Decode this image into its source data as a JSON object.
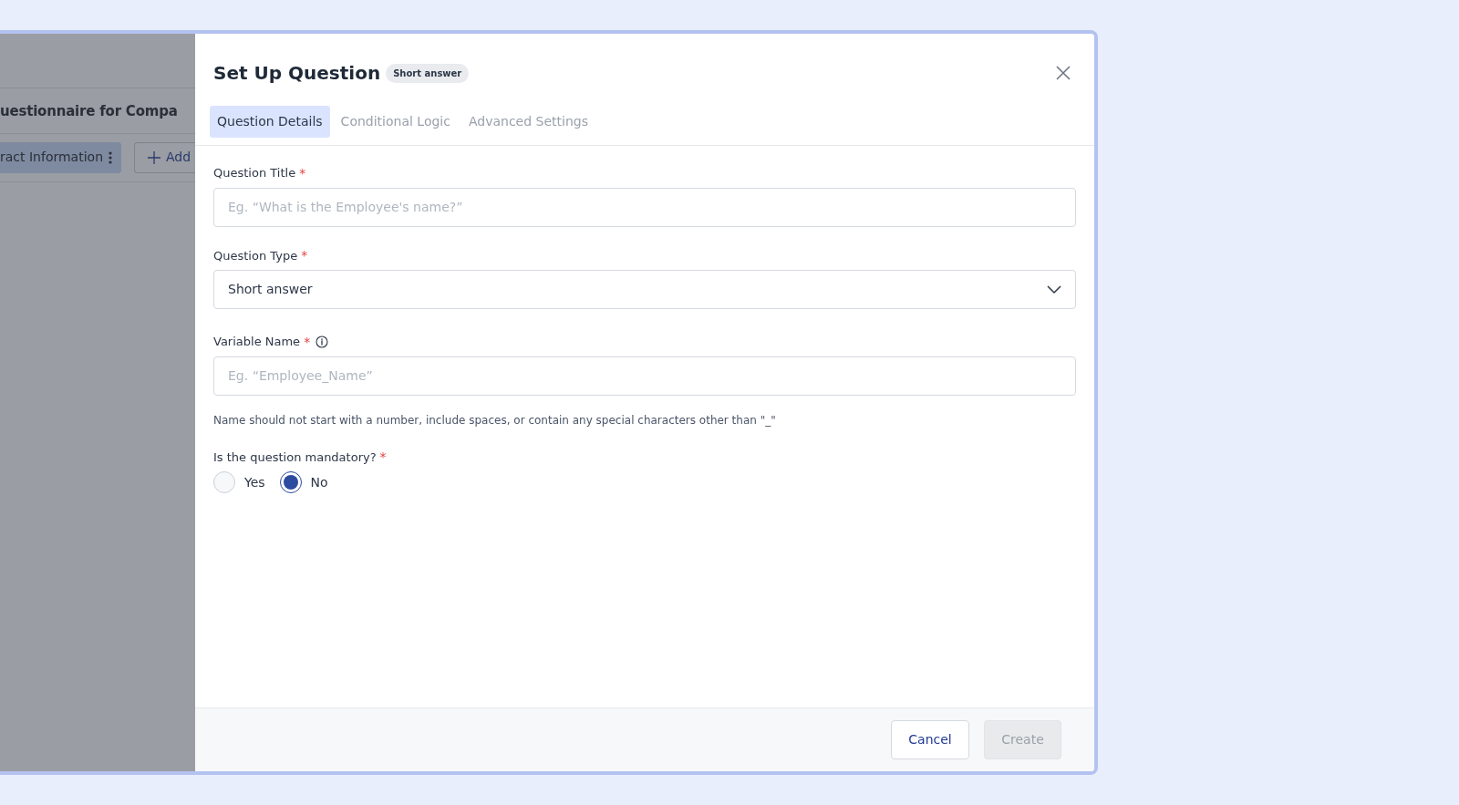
{
  "background_page": {
    "title": "uestionnaire for Compa",
    "section_tab": "ract Information",
    "add_button": "Add"
  },
  "dialog": {
    "title": "Set Up Question",
    "badge": "Short answer",
    "tabs": [
      {
        "label": "Question Details",
        "selected": true
      },
      {
        "label": "Conditional Logic",
        "selected": false
      },
      {
        "label": "Advanced Settings",
        "selected": false
      }
    ],
    "fields": [
      {
        "kind": "text",
        "label": "Question Title",
        "required_mark": "*",
        "placeholder": "Eg. “What is the Employee's name?”"
      },
      {
        "kind": "select",
        "label": "Question Type",
        "required_mark": "*",
        "value": "Short answer"
      },
      {
        "kind": "text",
        "label": "Variable Name",
        "required_mark": "*",
        "info": true,
        "placeholder": "Eg. “Employee_Name”",
        "hint": "Name should not start with a number, include spaces, or contain any special characters other than \"_\""
      },
      {
        "kind": "radio",
        "label": "Is the question mandatory?",
        "required_mark": "*",
        "options": [
          {
            "label": "Yes",
            "selected": false
          },
          {
            "label": "No",
            "selected": true
          }
        ]
      }
    ],
    "buttons": [
      {
        "label": "Cancel",
        "disabled": false
      },
      {
        "label": "Create",
        "disabled": true
      }
    ]
  }
}
